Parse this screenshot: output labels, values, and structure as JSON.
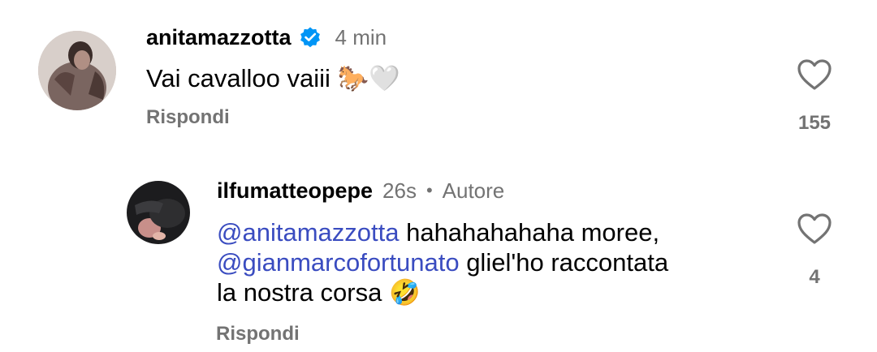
{
  "comments": [
    {
      "username": "anitamazzotta",
      "verified": true,
      "time": "4 min",
      "text": "Vai cavalloo vaiii",
      "emojis": "🐎🤍",
      "reply_label": "Rispondi",
      "likes": "155"
    },
    {
      "username": "ilfumatteopepe",
      "time": "26s",
      "separator": "•",
      "author_label": "Autore",
      "mention1": "@anitamazzotta",
      "text1": " hahahahahaha moree,",
      "mention2": "@gianmarcofortunato",
      "text2": " gliel'ho raccontata",
      "text3": "la nostra corsa",
      "emoji": "🤣",
      "reply_label": "Rispondi",
      "likes": "4"
    }
  ],
  "colors": {
    "secondary_text": "#737373",
    "mention": "#3a4cc0",
    "verified_badge": "#0095f6"
  }
}
